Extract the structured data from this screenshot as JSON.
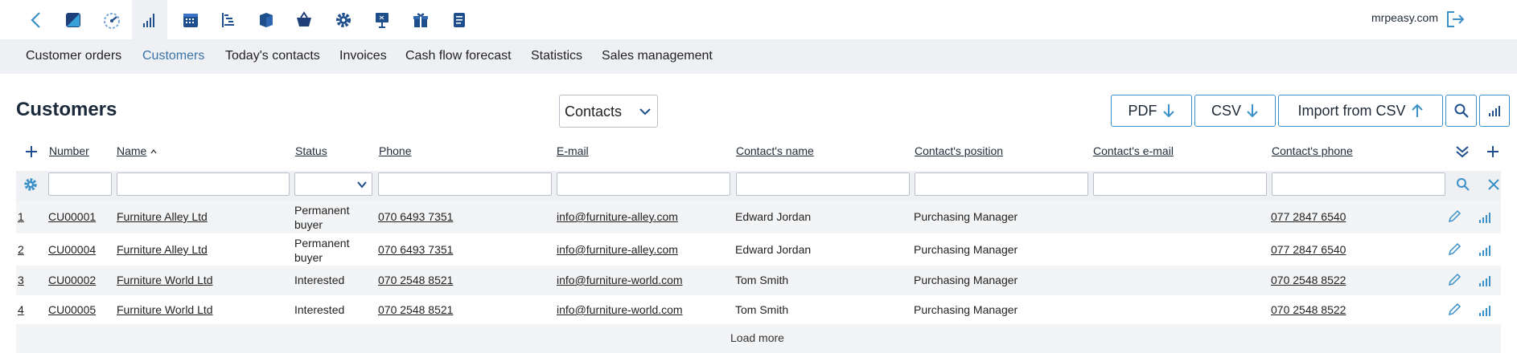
{
  "site": "mrpeasy.com",
  "subnav": [
    "Customer orders",
    "Customers",
    "Today's contacts",
    "Invoices",
    "Cash flow forecast",
    "Statistics",
    "Sales management"
  ],
  "subnav_active": "Customers",
  "page_title": "Customers",
  "view_select": {
    "value": "Contacts"
  },
  "buttons": {
    "pdf": "PDF",
    "csv": "CSV",
    "import": "Import from CSV"
  },
  "columns": [
    "Number",
    "Name",
    "Status",
    "Phone",
    "E-mail",
    "Contact's name",
    "Contact's position",
    "Contact's e-mail",
    "Contact's phone"
  ],
  "rows": [
    {
      "idx": "1",
      "number": "CU00001",
      "name": "Furniture Alley Ltd",
      "status": "Permanent buyer",
      "phone": "070 6493 7351",
      "email": "info@furniture-alley.com",
      "contact_name": "Edward Jordan",
      "contact_position": "Purchasing Manager",
      "contact_email": "",
      "contact_phone": "077 2847 6540"
    },
    {
      "idx": "2",
      "number": "CU00004",
      "name": "Furniture Alley Ltd",
      "status": "Permanent buyer",
      "phone": "070 6493 7351",
      "email": "info@furniture-alley.com",
      "contact_name": "Edward Jordan",
      "contact_position": "Purchasing Manager",
      "contact_email": "",
      "contact_phone": "077 2847 6540"
    },
    {
      "idx": "3",
      "number": "CU00002",
      "name": "Furniture World Ltd",
      "status": "Interested",
      "phone": "070 2548 8521",
      "email": "info@furniture-world.com",
      "contact_name": "Tom Smith",
      "contact_position": "Purchasing Manager",
      "contact_email": "",
      "contact_phone": "070 2548 8522"
    },
    {
      "idx": "4",
      "number": "CU00005",
      "name": "Furniture World Ltd",
      "status": "Interested",
      "phone": "070 2548 8521",
      "email": "info@furniture-world.com",
      "contact_name": "Tom Smith",
      "contact_position": "Purchasing Manager",
      "contact_email": "",
      "contact_phone": "070 2548 8522"
    }
  ],
  "load_more": "Load more",
  "icons": [
    "back-icon",
    "brand-icon",
    "dashboard-icon",
    "crm-icon",
    "calendar-icon",
    "planning-icon",
    "inventory-icon",
    "procurement-icon",
    "settings-icon",
    "presentation-icon",
    "gift-icon",
    "document-icon"
  ],
  "colors": {
    "accent": "#3a90c8",
    "icon": "#1f4e8c",
    "nav_bg": "#eef0f3"
  }
}
